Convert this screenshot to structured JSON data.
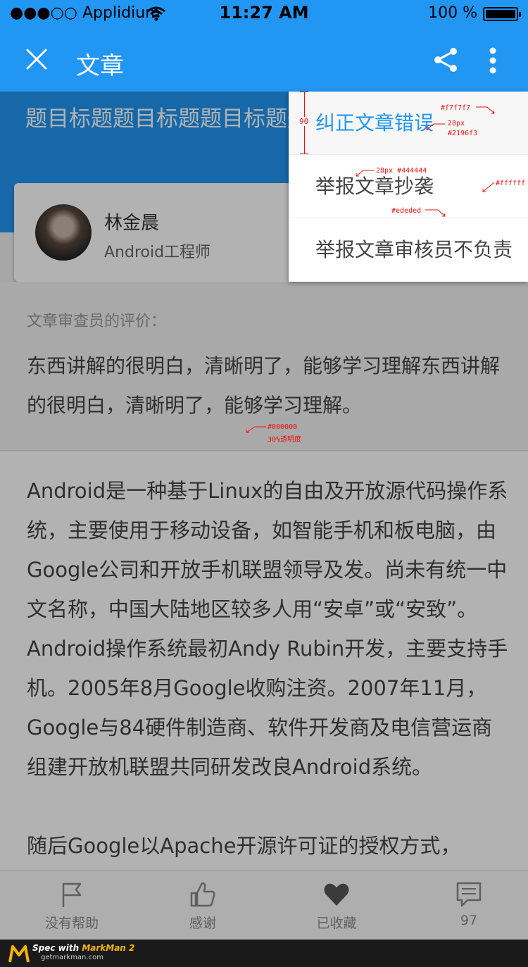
{
  "status_bar": {
    "carrier": "●●●○○ Applidium",
    "time": "11:27 AM",
    "battery": "100 %"
  },
  "toolbar": {
    "title": "文章"
  },
  "hero": {
    "headline": "题目标题题目标题题目标题题目标题"
  },
  "author": {
    "name": "林金晨",
    "role": "Android工程师"
  },
  "review": {
    "label": "文章审查员的评价：",
    "text": "东西讲解的很明白，清晰明了，能够学习理解东西讲解的很明白，清晰明了，能够学习理解。"
  },
  "article": {
    "paragraph1": "Android是一种基于Linux的自由及开放源代码操作系统，主要使用于移动设备，如智能手机和板电脑，由Google公司和开放手机联盟领导及发。尚未有统一中文名称，中国大陆地区较多人用“安卓”或“安致”。Android操作系统最初Andy Rubin开发，主要支持手机。2005年8月Google收购注资。2007年11月，Google与84硬件制造商、软件开发商及电信营运商组建开放机联盟共同研发改良Android系统。",
    "paragraph2": "随后Google以Apache开源许可证的授权方式，"
  },
  "menu": {
    "items": [
      "纠正文章错误",
      "举报文章抄袭",
      "举报文章审核员不负责"
    ]
  },
  "bottom_bar": {
    "tabs": [
      {
        "label": "没有帮助",
        "icon": "flag-icon"
      },
      {
        "label": "感谢",
        "icon": "thumbs-up-icon"
      },
      {
        "label": "已收藏",
        "icon": "heart-icon"
      },
      {
        "label": "97",
        "icon": "comment-icon"
      }
    ]
  },
  "spec_annotations": {
    "height": "90",
    "bg_active": "#f7f7f7",
    "font_size_active": "28px",
    "color_active": "#2196f3",
    "font_size_item": "28px #444444",
    "bg_menu": "#ffffff",
    "divider": "#ededed",
    "overlay_color": "#000000",
    "overlay_alpha": "30%透明度"
  },
  "watermark": {
    "line1_a": "Spec with ",
    "line1_b": "MarkMan 2",
    "line2": "getmarkman.com"
  },
  "colors": {
    "primary": "#2196f3",
    "text": "#444444",
    "divider": "#ededed",
    "active_bg": "#f7f7f7"
  }
}
